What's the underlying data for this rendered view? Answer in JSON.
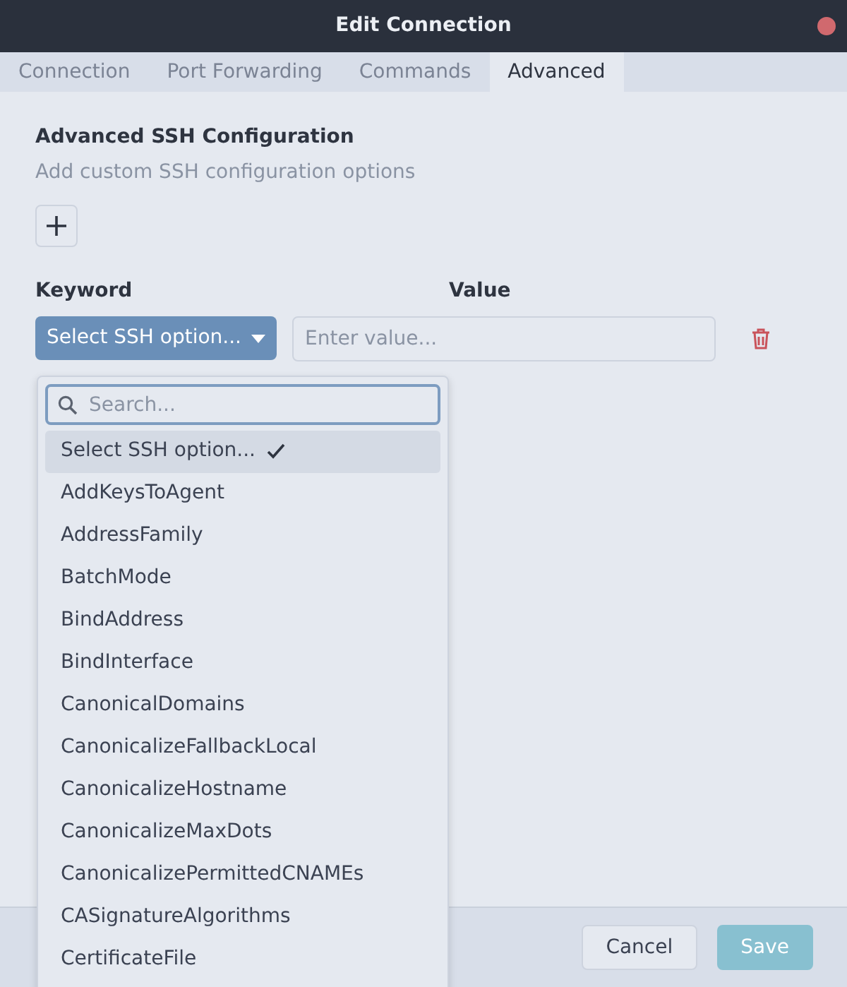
{
  "window": {
    "title": "Edit Connection"
  },
  "tabs": [
    {
      "label": "Connection",
      "selected": false
    },
    {
      "label": "Port Forwarding",
      "selected": false
    },
    {
      "label": "Commands",
      "selected": false
    },
    {
      "label": "Advanced",
      "selected": true
    }
  ],
  "section": {
    "title": "Advanced SSH Configuration",
    "subtitle": "Add custom SSH configuration options"
  },
  "columns": {
    "keyword": "Keyword",
    "value": "Value"
  },
  "option_row": {
    "keyword_select": "Select SSH option...",
    "value_placeholder": "Enter value..."
  },
  "dropdown": {
    "search_placeholder": "Search...",
    "items": [
      {
        "label": "Select SSH option...",
        "selected": true
      },
      {
        "label": "AddKeysToAgent",
        "selected": false
      },
      {
        "label": "AddressFamily",
        "selected": false
      },
      {
        "label": "BatchMode",
        "selected": false
      },
      {
        "label": "BindAddress",
        "selected": false
      },
      {
        "label": "BindInterface",
        "selected": false
      },
      {
        "label": "CanonicalDomains",
        "selected": false
      },
      {
        "label": "CanonicalizeFallbackLocal",
        "selected": false
      },
      {
        "label": "CanonicalizeHostname",
        "selected": false
      },
      {
        "label": "CanonicalizeMaxDots",
        "selected": false
      },
      {
        "label": "CanonicalizePermittedCNAMEs",
        "selected": false
      },
      {
        "label": "CASignatureAlgorithms",
        "selected": false
      },
      {
        "label": "CertificateFile",
        "selected": false
      }
    ]
  },
  "buttons": [
    {
      "label": "Cancel",
      "kind": "secondary",
      "disabled": false
    },
    {
      "label": "Save",
      "kind": "primary",
      "disabled": true
    }
  ]
}
